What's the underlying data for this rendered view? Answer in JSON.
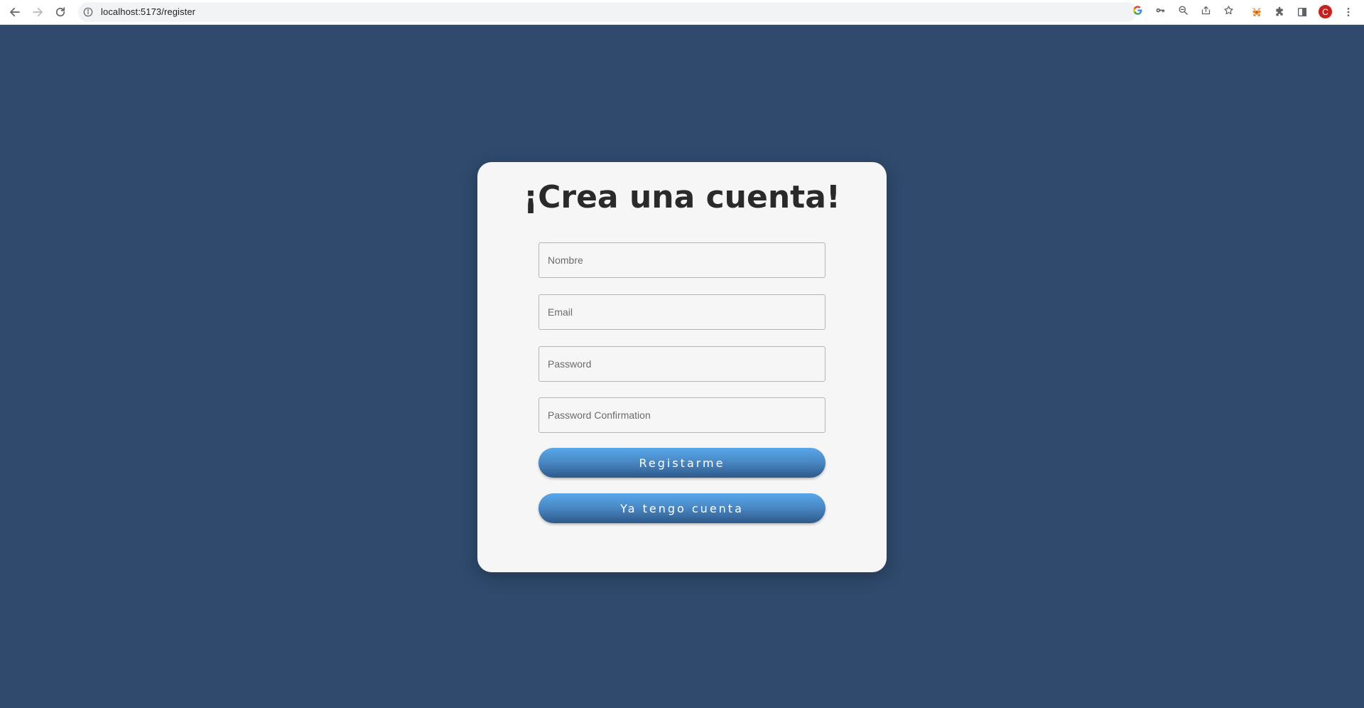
{
  "browser": {
    "url": "localhost:5173/register",
    "avatar_letter": "C",
    "icons": {
      "back": "arrow-left-icon",
      "forward": "arrow-right-icon",
      "reload": "reload-icon",
      "site_info": "info-icon",
      "google": "google-icon",
      "password_key": "key-icon",
      "zoom": "zoom-out-icon",
      "share": "share-icon",
      "bookmark": "star-icon",
      "metamask": "fox-icon",
      "extensions": "puzzle-icon",
      "side_panel": "side-panel-icon",
      "menu": "kebab-menu-icon"
    }
  },
  "page": {
    "background_color": "#2f4a6d",
    "card_color": "#f6f6f6",
    "title": "¡Crea una cuenta!",
    "fields": {
      "name_placeholder": "Nombre",
      "email_placeholder": "Email",
      "password_placeholder": "Password",
      "password_confirmation_placeholder": "Password Confirmation"
    },
    "buttons": {
      "register_label": "Registarme",
      "have_account_label": "Ya tengo cuenta"
    },
    "button_color": "#4a89c6"
  }
}
